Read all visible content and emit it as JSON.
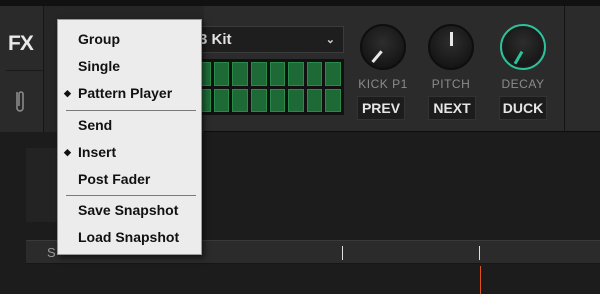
{
  "fx": {
    "label": "FX"
  },
  "kit_select": {
    "value": "3 Kit",
    "chevron": "⌄"
  },
  "step_grid": {
    "rows": 2,
    "cols": 8
  },
  "knobs": [
    {
      "id": "kick",
      "label": "KICK P1",
      "button": "PREV"
    },
    {
      "id": "pitch",
      "label": "PITCH",
      "button": "NEXT"
    },
    {
      "id": "decay",
      "label": "DECAY",
      "button": "DUCK"
    }
  ],
  "colors": {
    "accent_green": "#2ec29a",
    "step_green": "#2fa256",
    "playhead": "#e2511e",
    "menu_bg": "#ececec"
  },
  "timeline": {
    "tab_label": "S"
  },
  "menu": {
    "groups": [
      {
        "items": [
          {
            "label": "Group",
            "checked": false
          },
          {
            "label": "Single",
            "checked": false
          },
          {
            "label": "Pattern Player",
            "checked": true
          }
        ]
      },
      {
        "items": [
          {
            "label": "Send",
            "checked": false
          },
          {
            "label": "Insert",
            "checked": true
          },
          {
            "label": "Post Fader",
            "checked": false
          }
        ]
      },
      {
        "items": [
          {
            "label": "Save Snapshot",
            "checked": false
          },
          {
            "label": "Load Snapshot",
            "checked": false
          }
        ]
      }
    ],
    "check_glyph": "◆"
  }
}
